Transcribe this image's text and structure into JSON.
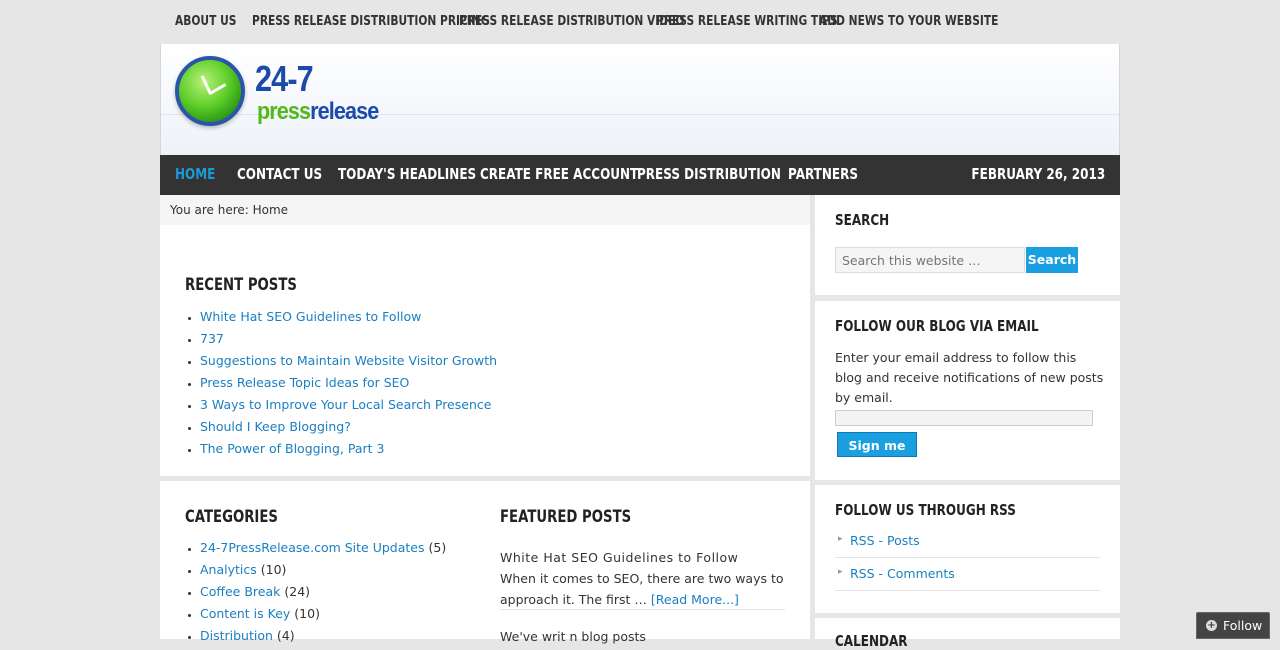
{
  "top_nav": [
    "ABOUT US",
    "PRESS RELEASE DISTRIBUTION PRICING",
    "PRESS RELEASE DISTRIBUTION VIDEO",
    "PRESS RELEASE WRITING TIPS",
    "ADD NEWS TO YOUR WEBSITE"
  ],
  "logo": {
    "number": "24-7",
    "brand_part1": "press",
    "brand_part2": "release"
  },
  "main_nav": {
    "items": [
      "HOME",
      "CONTACT US",
      "TODAY'S HEADLINES",
      "CREATE FREE ACCOUNT",
      "PRESS DISTRIBUTION",
      "PARTNERS"
    ],
    "active": "HOME",
    "date": "FEBRUARY 26, 2013"
  },
  "breadcrumb": "You are here: Home",
  "recent_posts": {
    "title": "RECENT POSTS",
    "items": [
      "White Hat SEO Guidelines to Follow",
      "737",
      "Suggestions to Maintain Website Visitor Growth",
      "Press Release Topic Ideas for SEO",
      "3 Ways to Improve Your Local Search Presence",
      "Should I Keep Blogging?",
      "The Power of Blogging, Part 3"
    ]
  },
  "categories": {
    "title": "CATEGORIES",
    "items": [
      {
        "name": "24-7PressRelease.com Site Updates",
        "count": "(5)"
      },
      {
        "name": "Analytics",
        "count": "(10)"
      },
      {
        "name": "Coffee Break",
        "count": "(24)"
      },
      {
        "name": "Content is Key",
        "count": "(10)"
      },
      {
        "name": "Distribution",
        "count": "(4)"
      }
    ]
  },
  "featured_posts": {
    "title": "FEATURED POSTS",
    "post_title": "White Hat SEO Guidelines to Follow",
    "excerpt_line1": "When it comes to SEO, there are two ways to",
    "excerpt_line2": "approach it.  The first … ",
    "read_more": "[Read More...]",
    "next_excerpt": "We've writ n blog posts "
  },
  "sidebar": {
    "search": {
      "title": "SEARCH",
      "placeholder": "Search this website …",
      "button": "Search"
    },
    "email": {
      "title": "FOLLOW OUR BLOG VIA EMAIL",
      "text": "Enter your email address to follow this blog and receive notifications of new posts by email.",
      "button": "Sign me up!"
    },
    "rss": {
      "title": "FOLLOW US THROUGH RSS",
      "items": [
        "RSS - Posts",
        "RSS - Comments"
      ]
    },
    "calendar_title": "CALENDAR"
  },
  "follow_button": "Follow",
  "colors": {
    "accent": "#1a9ad6",
    "nav_bg": "#333333",
    "link": "#1a7fc1",
    "button": "#1aa0e0"
  }
}
